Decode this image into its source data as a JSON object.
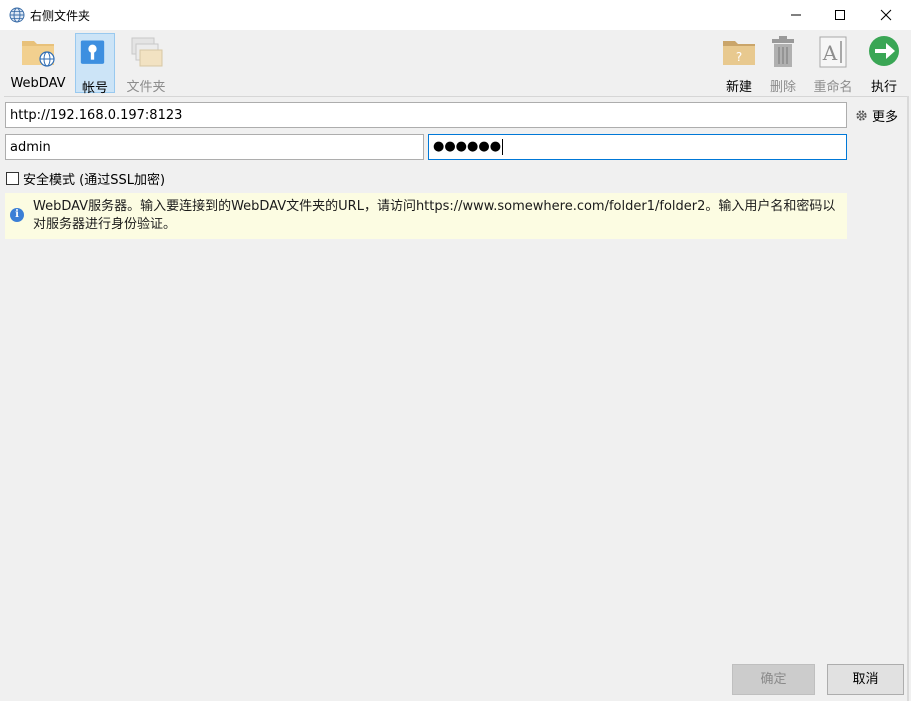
{
  "window": {
    "title": "右侧文件夹"
  },
  "toolbar": {
    "left": [
      {
        "label": "WebDAV",
        "icon": "webdav-folder-icon"
      },
      {
        "label": "帐号",
        "icon": "key-icon",
        "selected": true
      },
      {
        "label": "文件夹",
        "icon": "folders-icon",
        "disabled": true
      }
    ],
    "right": [
      {
        "label": "新建",
        "icon": "new-folder-icon"
      },
      {
        "label": "删除",
        "icon": "trash-icon",
        "disabled": true
      },
      {
        "label": "重命名",
        "icon": "rename-icon",
        "disabled": true
      },
      {
        "label": "执行",
        "icon": "go-arrow-icon"
      }
    ]
  },
  "form": {
    "url": "http://192.168.0.197:8123",
    "username": "admin",
    "password_mask": "●●●●●●",
    "more_label": "更多",
    "secure_label": "安全模式 (通过SSL加密)"
  },
  "info": {
    "text": "WebDAV服务器。输入要连接到的WebDAV文件夹的URL，请访问https://www.somewhere.com/folder1/folder2。输入用户名和密码以对服务器进行身份验证。"
  },
  "buttons": {
    "ok": "确定",
    "cancel": "取消"
  },
  "colors": {
    "accent": "#0078d7",
    "selected_bg": "#cce4f7",
    "info_bg": "#fcfce2",
    "go_green": "#3aa655"
  }
}
